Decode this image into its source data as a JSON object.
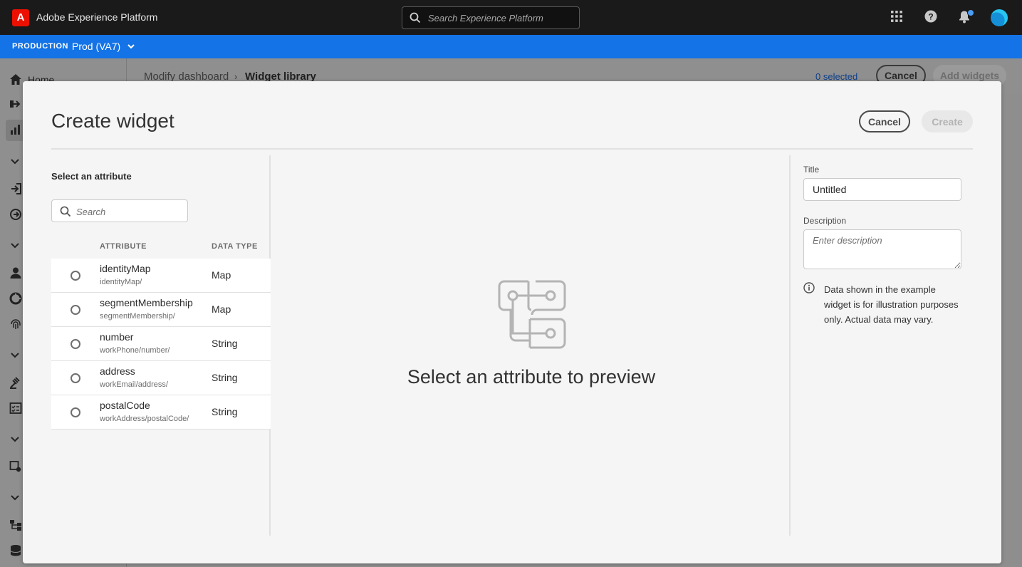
{
  "header": {
    "logo_letter": "A",
    "app_title": "Adobe Experience Platform",
    "search_placeholder": "Search Experience Platform"
  },
  "environment": {
    "label": "PRODUCTION",
    "value": "Prod (VA7)"
  },
  "sidebar": {
    "home_label": "Home"
  },
  "background_page": {
    "breadcrumb": [
      "Modify dashboard",
      "Widget library"
    ],
    "selected_count": "0 selected",
    "cancel_label": "Cancel",
    "add_widgets_label": "Add widgets"
  },
  "modal": {
    "title": "Create widget",
    "cancel_label": "Cancel",
    "create_label": "Create",
    "attributes": {
      "heading": "Select an attribute",
      "search_placeholder": "Search",
      "columns": [
        "ATTRIBUTE",
        "DATA TYPE"
      ],
      "rows": [
        {
          "name": "identityMap",
          "path": "identityMap/",
          "type": "Map"
        },
        {
          "name": "segmentMembership",
          "path": "segmentMembership/",
          "type": "Map"
        },
        {
          "name": "number",
          "path": "workPhone/number/",
          "type": "String"
        },
        {
          "name": "address",
          "path": "workEmail/address/",
          "type": "String"
        },
        {
          "name": "postalCode",
          "path": "workAddress/postalCode/",
          "type": "String"
        }
      ]
    },
    "preview": {
      "message": "Select an attribute to preview"
    },
    "properties": {
      "title_label": "Title",
      "title_value": "Untitled",
      "description_label": "Description",
      "description_placeholder": "Enter description",
      "info_text": "Data shown in the example widget is for illustration purposes only. Actual data may vary."
    }
  },
  "colors": {
    "header_bg": "#1a1a1a",
    "env_bar": "#1473e6",
    "brand_red": "#eb1000",
    "notification_dot": "#4b9cf5"
  }
}
